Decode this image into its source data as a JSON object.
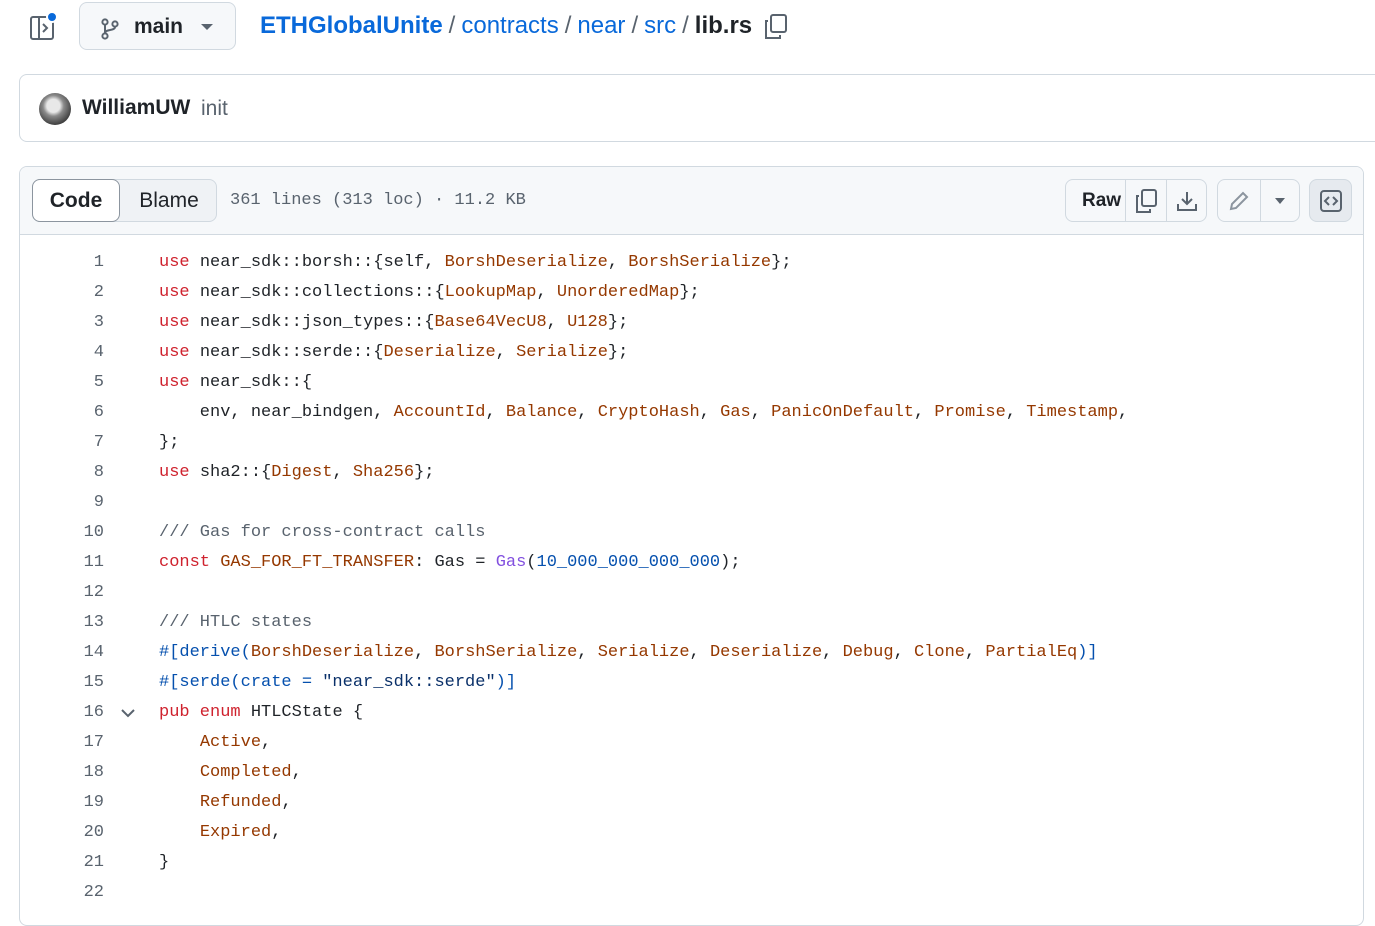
{
  "branch": {
    "name": "main"
  },
  "breadcrumb": {
    "repo": "ETHGlobalUnite",
    "parts": [
      "contracts",
      "near",
      "src"
    ],
    "current": "lib.rs",
    "separator": "/"
  },
  "commit": {
    "author": "WilliamUW",
    "message": "init"
  },
  "file": {
    "tabs": {
      "code": "Code",
      "blame": "Blame"
    },
    "meta": "361 lines (313 loc) · 11.2 KB",
    "raw_label": "Raw"
  },
  "icons": [
    "sidebar-toggle-icon",
    "git-branch-icon",
    "triangle-down-icon",
    "copy-icon",
    "download-icon",
    "pencil-icon",
    "code-square-icon",
    "chevron-down-icon"
  ],
  "colors": {
    "link": "#0969da",
    "keyword": "#cf222e",
    "type": "#953800",
    "number": "#0550ae",
    "comment": "#59636e",
    "fn": "#8250df"
  },
  "code": {
    "lines": [
      {
        "n": "1",
        "tokens": [
          [
            "kw",
            "use"
          ],
          [
            "",
            "near_sdk::borsh::{self, "
          ],
          [
            "ty",
            "BorshDeserialize"
          ],
          [
            "",
            ", "
          ],
          [
            "ty",
            "BorshSerialize"
          ],
          [
            "",
            "};"
          ]
        ]
      },
      {
        "n": "2",
        "tokens": [
          [
            "kw",
            "use"
          ],
          [
            "",
            "near_sdk::collections::{"
          ],
          [
            "ty",
            "LookupMap"
          ],
          [
            "",
            ", "
          ],
          [
            "ty",
            "UnorderedMap"
          ],
          [
            "",
            "};"
          ]
        ]
      },
      {
        "n": "3",
        "tokens": [
          [
            "kw",
            "use"
          ],
          [
            "",
            "near_sdk::json_types::{"
          ],
          [
            "ty",
            "Base64VecU8"
          ],
          [
            "",
            ", "
          ],
          [
            "ty",
            "U128"
          ],
          [
            "",
            "};"
          ]
        ]
      },
      {
        "n": "4",
        "tokens": [
          [
            "kw",
            "use"
          ],
          [
            "",
            "near_sdk::serde::{"
          ],
          [
            "ty",
            "Deserialize"
          ],
          [
            "",
            ", "
          ],
          [
            "ty",
            "Serialize"
          ],
          [
            "",
            "};"
          ]
        ]
      },
      {
        "n": "5",
        "tokens": [
          [
            "kw",
            "use"
          ],
          [
            "",
            "near_sdk::{"
          ]
        ]
      },
      {
        "n": "6",
        "tokens": [
          [
            "",
            "    env, near_bindgen, "
          ],
          [
            "ty",
            "AccountId"
          ],
          [
            "",
            ", "
          ],
          [
            "ty",
            "Balance"
          ],
          [
            "",
            ", "
          ],
          [
            "ty",
            "CryptoHash"
          ],
          [
            "",
            ", "
          ],
          [
            "ty",
            "Gas"
          ],
          [
            "",
            ", "
          ],
          [
            "ty",
            "PanicOnDefault"
          ],
          [
            "",
            ", "
          ],
          [
            "ty",
            "Promise"
          ],
          [
            "",
            ", "
          ],
          [
            "ty",
            "Timestamp"
          ],
          [
            "",
            ","
          ]
        ]
      },
      {
        "n": "7",
        "tokens": [
          [
            "",
            "};"
          ]
        ]
      },
      {
        "n": "8",
        "tokens": [
          [
            "kw",
            "use"
          ],
          [
            "",
            "sha2::{"
          ],
          [
            "ty",
            "Digest"
          ],
          [
            "",
            ", "
          ],
          [
            "ty",
            "Sha256"
          ],
          [
            "",
            "};"
          ]
        ]
      },
      {
        "n": "9",
        "tokens": []
      },
      {
        "n": "10",
        "tokens": [
          [
            "cm",
            "/// Gas for cross-contract calls"
          ]
        ]
      },
      {
        "n": "11",
        "tokens": [
          [
            "kw",
            "const"
          ],
          [
            "ty",
            "GAS_FOR_FT_TRANSFER"
          ],
          [
            "",
            ": Gas = "
          ],
          [
            "fn",
            "Gas"
          ],
          [
            "",
            "("
          ],
          [
            "nm",
            "10_000_000_000_000"
          ],
          [
            "",
            ");"
          ]
        ]
      },
      {
        "n": "12",
        "tokens": []
      },
      {
        "n": "13",
        "tokens": [
          [
            "cm",
            "/// HTLC states"
          ]
        ]
      },
      {
        "n": "14",
        "tokens": [
          [
            "at",
            "#[derive("
          ],
          [
            "ty",
            "BorshDeserialize"
          ],
          [
            "",
            ", "
          ],
          [
            "ty",
            "BorshSerialize"
          ],
          [
            "",
            ", "
          ],
          [
            "ty",
            "Serialize"
          ],
          [
            "",
            ", "
          ],
          [
            "ty",
            "Deserialize"
          ],
          [
            "",
            ", "
          ],
          [
            "ty",
            "Debug"
          ],
          [
            "",
            ", "
          ],
          [
            "ty",
            "Clone"
          ],
          [
            "",
            ", "
          ],
          [
            "ty",
            "PartialEq"
          ],
          [
            "at",
            ")]"
          ]
        ]
      },
      {
        "n": "15",
        "tokens": [
          [
            "at",
            "#[serde(crate = "
          ],
          [
            "st",
            "\"near_sdk::serde\""
          ],
          [
            "at",
            ")]"
          ]
        ]
      },
      {
        "n": "16",
        "tokens": [
          [
            "kw",
            "pub enum"
          ],
          [
            "",
            "HTLCState {"
          ]
        ],
        "fold": true
      },
      {
        "n": "17",
        "tokens": [
          [
            "",
            "    "
          ],
          [
            "ty",
            "Active"
          ],
          [
            "",
            ","
          ]
        ]
      },
      {
        "n": "18",
        "tokens": [
          [
            "",
            "    "
          ],
          [
            "ty",
            "Completed"
          ],
          [
            "",
            ","
          ]
        ]
      },
      {
        "n": "19",
        "tokens": [
          [
            "",
            "    "
          ],
          [
            "ty",
            "Refunded"
          ],
          [
            "",
            ","
          ]
        ]
      },
      {
        "n": "20",
        "tokens": [
          [
            "",
            "    "
          ],
          [
            "ty",
            "Expired"
          ],
          [
            "",
            ","
          ]
        ]
      },
      {
        "n": "21",
        "tokens": [
          [
            "",
            "}"
          ]
        ]
      },
      {
        "n": "22",
        "tokens": []
      }
    ]
  }
}
